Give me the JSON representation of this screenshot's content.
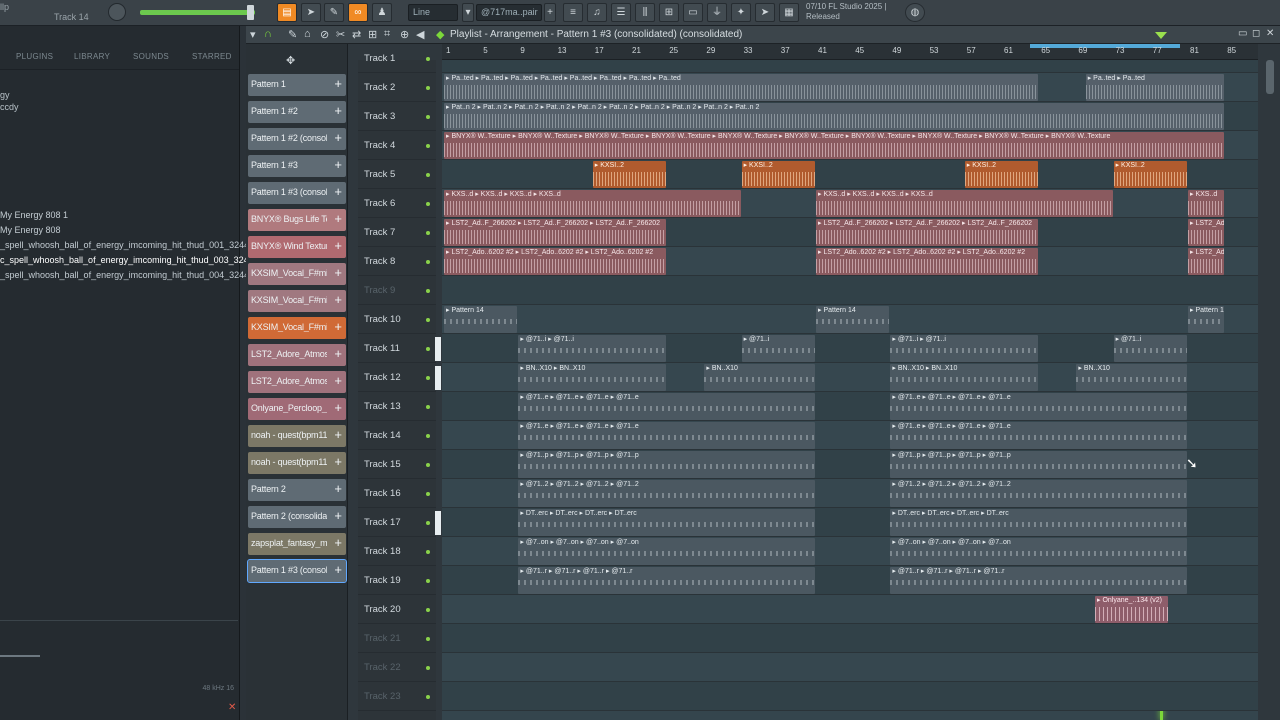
{
  "toolbar": {
    "hint_text": "llp",
    "hint_track": "Track 14",
    "snap_mode": "Line",
    "pattern_field": "@717ma..pair",
    "version_line1": "07/10 FL Studio 2025 |",
    "version_line2": "Released"
  },
  "browser": {
    "tabs": [
      "PLUGINS",
      "LIBRARY",
      "SOUNDS",
      "STARRED"
    ],
    "fragments": [
      "gy",
      "ccdy"
    ],
    "items": [
      "My Energy 808 1",
      "My Energy 808",
      "_spell_whoosh_ball_of_energy_imcoming_hit_thud_001_32440",
      "c_spell_whoosh_ball_of_energy_imcoming_hit_thud_003_32442",
      "_spell_whoosh_ball_of_energy_imcoming_hit_thud_004_32443"
    ],
    "scope_info": "48 kHz 16"
  },
  "playlist": {
    "title": "Playlist - Arrangement - Pattern 1 #3 (consolidated) (consolidated)"
  },
  "picker": [
    {
      "label": "Pattern 1",
      "color": "#5f6b74"
    },
    {
      "label": "Pattern 1 #2",
      "color": "#5f6b74"
    },
    {
      "label": "Pattern 1 #2 (consoli...",
      "color": "#5f6b74"
    },
    {
      "label": "Pattern 1 #3",
      "color": "#5f6b74"
    },
    {
      "label": "Pattern 1 #3 (consoli...",
      "color": "#5f6b74"
    },
    {
      "label": "BNYX® Bugs Life Te...",
      "color": "#b07a7e"
    },
    {
      "label": "BNYX® Wind Texture",
      "color": "#b06a70"
    },
    {
      "label": "KXSIM_Vocal_F#min...",
      "color": "#a07880"
    },
    {
      "label": "KXSIM_Vocal_F#min...",
      "color": "#a07880"
    },
    {
      "label": "KXSIM_Vocal_F#min...",
      "color": "#d06a36"
    },
    {
      "label": "LST2_Adore_Atmosp...",
      "color": "#a0727c"
    },
    {
      "label": "LST2_Adore_Atmosp...",
      "color": "#a0727c"
    },
    {
      "label": "Onlyane_Percloop_i...",
      "color": "#a06a76"
    },
    {
      "label": "noah - quest(bpm11...",
      "color": "#7c7866"
    },
    {
      "label": "noah - quest(bpm11...",
      "color": "#7c7866"
    },
    {
      "label": "Pattern 2",
      "color": "#5f6b74"
    },
    {
      "label": "Pattern 2 (consolidat...",
      "color": "#5f6b74"
    },
    {
      "label": "zapsplat_fantasy_m...",
      "color": "#7c7866"
    },
    {
      "label": "Pattern 1 #3 (consoli...",
      "color": "#5f6b74"
    }
  ],
  "ruler": [
    "1",
    "5",
    "9",
    "13",
    "17",
    "21",
    "25",
    "29",
    "33",
    "37",
    "41",
    "45",
    "49",
    "53",
    "57",
    "61",
    "65",
    "69",
    "73",
    "77",
    "81",
    "85"
  ],
  "tracks": [
    {
      "name": "Track 1",
      "dim": false
    },
    {
      "name": "Track 2",
      "dim": false
    },
    {
      "name": "Track 3",
      "dim": false
    },
    {
      "name": "Track 4",
      "dim": false
    },
    {
      "name": "Track 5",
      "dim": false
    },
    {
      "name": "Track 6",
      "dim": false
    },
    {
      "name": "Track 7",
      "dim": false
    },
    {
      "name": "Track 8",
      "dim": false
    },
    {
      "name": "Track 9",
      "dim": true
    },
    {
      "name": "Track 10",
      "dim": false
    },
    {
      "name": "Track 11",
      "dim": false
    },
    {
      "name": "Track 12",
      "dim": false
    },
    {
      "name": "Track 13",
      "dim": false
    },
    {
      "name": "Track 14",
      "dim": false
    },
    {
      "name": "Track 15",
      "dim": false
    },
    {
      "name": "Track 16",
      "dim": false
    },
    {
      "name": "Track 17",
      "dim": false
    },
    {
      "name": "Track 18",
      "dim": false
    },
    {
      "name": "Track 19",
      "dim": false
    },
    {
      "name": "Track 20",
      "dim": false
    },
    {
      "name": "Track 21",
      "dim": true
    },
    {
      "name": "Track 22",
      "dim": true
    },
    {
      "name": "Track 23",
      "dim": true
    }
  ],
  "clips": [
    {
      "track": 2,
      "label": "Pa..ted",
      "kind": "gray",
      "segments": [
        [
          1,
          65
        ],
        [
          70,
          85
        ]
      ]
    },
    {
      "track": 3,
      "label": "Pat..n 2",
      "kind": "gray",
      "segments": [
        [
          1,
          85
        ]
      ]
    },
    {
      "track": 4,
      "label": "BNYX® W..Texture",
      "kind": "red",
      "segments": [
        [
          1,
          85
        ]
      ]
    },
    {
      "track": 5,
      "label": "KXSI..2",
      "kind": "orange",
      "segments": [
        [
          17,
          25
        ],
        [
          33,
          41
        ],
        [
          57,
          65
        ],
        [
          73,
          81
        ]
      ]
    },
    {
      "track": 6,
      "label": "KXS..d",
      "kind": "red",
      "segments": [
        [
          1,
          33
        ],
        [
          41,
          73
        ],
        [
          81,
          85
        ]
      ]
    },
    {
      "track": 7,
      "label": "LST2_Ad..F_266202",
      "kind": "red",
      "segments": [
        [
          1,
          25
        ],
        [
          41,
          65
        ],
        [
          81,
          85
        ]
      ]
    },
    {
      "track": 8,
      "label": "LST2_Ado..6202 #2",
      "kind": "red",
      "segments": [
        [
          1,
          25
        ],
        [
          41,
          65
        ],
        [
          81,
          85
        ]
      ]
    },
    {
      "track": 10,
      "label": "Pattern 14",
      "kind": "pat",
      "segments": [
        [
          1,
          9
        ],
        [
          41,
          49
        ],
        [
          81,
          85
        ]
      ]
    },
    {
      "track": 11,
      "label": "@71..i",
      "kind": "pat",
      "segments": [
        [
          9,
          25
        ],
        [
          33,
          41
        ],
        [
          49,
          65
        ],
        [
          73,
          81
        ]
      ]
    },
    {
      "track": 12,
      "label": "BN..X10",
      "kind": "pat",
      "segments": [
        [
          9,
          25
        ],
        [
          29,
          41
        ],
        [
          49,
          65
        ],
        [
          69,
          81
        ]
      ]
    },
    {
      "track": 13,
      "label": "@71..e",
      "kind": "pat",
      "segments": [
        [
          9,
          41
        ],
        [
          49,
          81
        ]
      ]
    },
    {
      "track": 14,
      "label": "@71..e",
      "kind": "pat",
      "segments": [
        [
          9,
          41
        ],
        [
          49,
          81
        ]
      ]
    },
    {
      "track": 15,
      "label": "@71..p",
      "kind": "pat",
      "segments": [
        [
          9,
          41
        ],
        [
          49,
          81
        ]
      ]
    },
    {
      "track": 16,
      "label": "@71..2",
      "kind": "pat",
      "segments": [
        [
          9,
          41
        ],
        [
          49,
          81
        ]
      ]
    },
    {
      "track": 17,
      "label": "DT..erc",
      "kind": "pat",
      "segments": [
        [
          9,
          41
        ],
        [
          49,
          81
        ]
      ]
    },
    {
      "track": 18,
      "label": "@7..on",
      "kind": "pat",
      "segments": [
        [
          9,
          41
        ],
        [
          49,
          81
        ]
      ]
    },
    {
      "track": 19,
      "label": "@71..r",
      "kind": "pat",
      "segments": [
        [
          9,
          41
        ],
        [
          49,
          81
        ]
      ]
    },
    {
      "track": 20,
      "label": "Onlyane_..134 (v2)",
      "kind": "pink",
      "segments": [
        [
          71,
          79
        ]
      ]
    }
  ],
  "playhead_bar": 78
}
